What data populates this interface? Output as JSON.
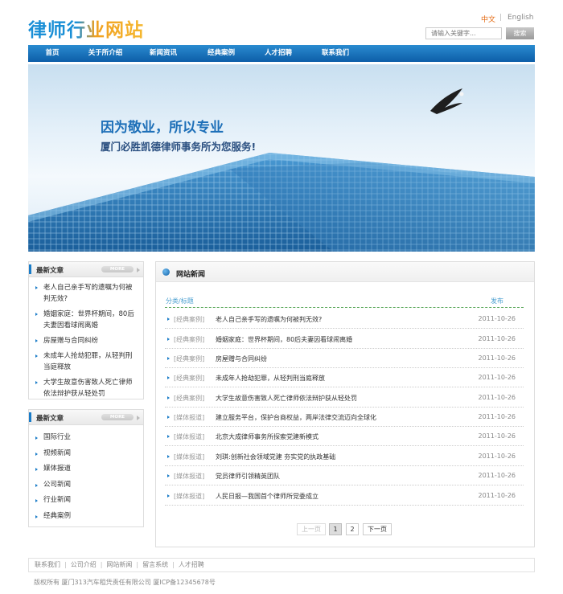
{
  "header": {
    "logo": "律师行业网站",
    "lang_cn": "中文",
    "lang_sep": "|",
    "lang_en": "English",
    "search_placeholder": "请输入关键字...",
    "search_button": "搜索"
  },
  "nav": {
    "items": [
      "首页",
      "关于所介绍",
      "新闻资讯",
      "经典案例",
      "人才招聘",
      "联系我们"
    ]
  },
  "banner": {
    "title": "因为敬业，所以专业",
    "subtitle": "厦门必胜凯德律师事务所为您服务!"
  },
  "sidebar": {
    "articles": {
      "title": "最新文章",
      "more": "MORE",
      "items": [
        "老人自己亲手写的遗嘱为何被判无效?",
        "婚姻家庭：世界杯期间，80后夫妻因看球闹离婚",
        "房屋赠与合同纠纷",
        "未成年人抢劫犯罪，从轻判刑当庭释放",
        "大学生故意伤害致人死亡律师依法辩护获从轻处罚"
      ]
    },
    "categories": {
      "title": "最新文章",
      "more": "MORE",
      "items": [
        "国际行业",
        "视频新闻",
        "媒体报道",
        "公司新闻",
        "行业新闻",
        "经典案例"
      ]
    }
  },
  "news": {
    "title": "网站新闻",
    "col_category": "分类/标题",
    "col_date": "发布",
    "rows": [
      {
        "cat": "[经典案例]",
        "title": "老人自己亲手写的遗嘱为何被判无效?",
        "date": "2011-10-26"
      },
      {
        "cat": "[经典案例]",
        "title": "婚姻家庭：世界杯期间，80后夫妻因看球闹离婚",
        "date": "2011-10-26"
      },
      {
        "cat": "[经典案例]",
        "title": "房屋赠与合同纠纷",
        "date": "2011-10-26"
      },
      {
        "cat": "[经典案例]",
        "title": "未成年人抢劫犯罪，从轻判刑当庭释放",
        "date": "2011-10-26"
      },
      {
        "cat": "[经典案例]",
        "title": "大学生故意伤害致人死亡律师依法辩护获从轻处罚",
        "date": "2011-10-26"
      },
      {
        "cat": "[媒体报道]",
        "title": "建立服务平台，保护台商权益，两岸法律交流迈向全球化",
        "date": "2011-10-26"
      },
      {
        "cat": "[媒体报道]",
        "title": "北京大成律师事务所探索党建新模式",
        "date": "2011-10-26"
      },
      {
        "cat": "[媒体报道]",
        "title": "刘琪:创新社会领域党建 夯实党的执政基础",
        "date": "2011-10-26"
      },
      {
        "cat": "[媒体报道]",
        "title": "党员律师引领精英团队",
        "date": "2011-10-26"
      },
      {
        "cat": "[媒体报道]",
        "title": "人民日报—我国首个律师所党委成立",
        "date": "2011-10-26"
      }
    ]
  },
  "pager": {
    "prev": "上一页",
    "page1": "1",
    "page2": "2",
    "next": "下一页"
  },
  "footer": {
    "links": [
      "联系我们",
      "公司介绍",
      "网站新闻",
      "留言系统",
      "人才招聘"
    ],
    "copyright": "版权所有 厦门313汽车租凭责任有限公司 厦ICP备12345678号"
  }
}
